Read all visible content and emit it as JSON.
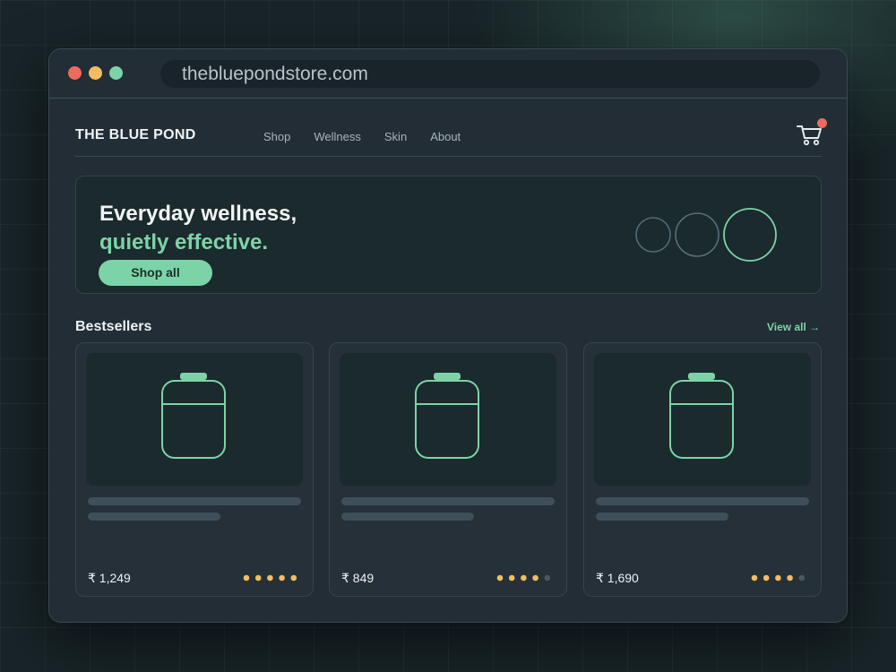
{
  "browser": {
    "url": "thebluepondstore.com"
  },
  "header": {
    "brand": "THE BLUE POND",
    "nav": [
      "Shop",
      "Wellness",
      "Skin",
      "About"
    ],
    "cart_icon": "cart-icon",
    "cart_badge_color": "#ee6a5f"
  },
  "hero": {
    "line1": "Everyday wellness,",
    "line2": "quietly effective.",
    "cta": "Shop all"
  },
  "bestsellers": {
    "title": "Bestsellers",
    "view_all": "View all →",
    "products": [
      {
        "price": "₹ 1,249",
        "rating": 5,
        "rating_max": 5,
        "icon": "jar-icon"
      },
      {
        "price": "₹ 849",
        "rating": 4,
        "rating_max": 5,
        "icon": "jar-icon"
      },
      {
        "price": "₹ 1,690",
        "rating": 4,
        "rating_max": 5,
        "icon": "jar-icon"
      }
    ]
  },
  "colors": {
    "accent": "#7dd3a8",
    "star": "#f2bd62",
    "star_empty": "#4a5860",
    "background": "#222d35"
  }
}
